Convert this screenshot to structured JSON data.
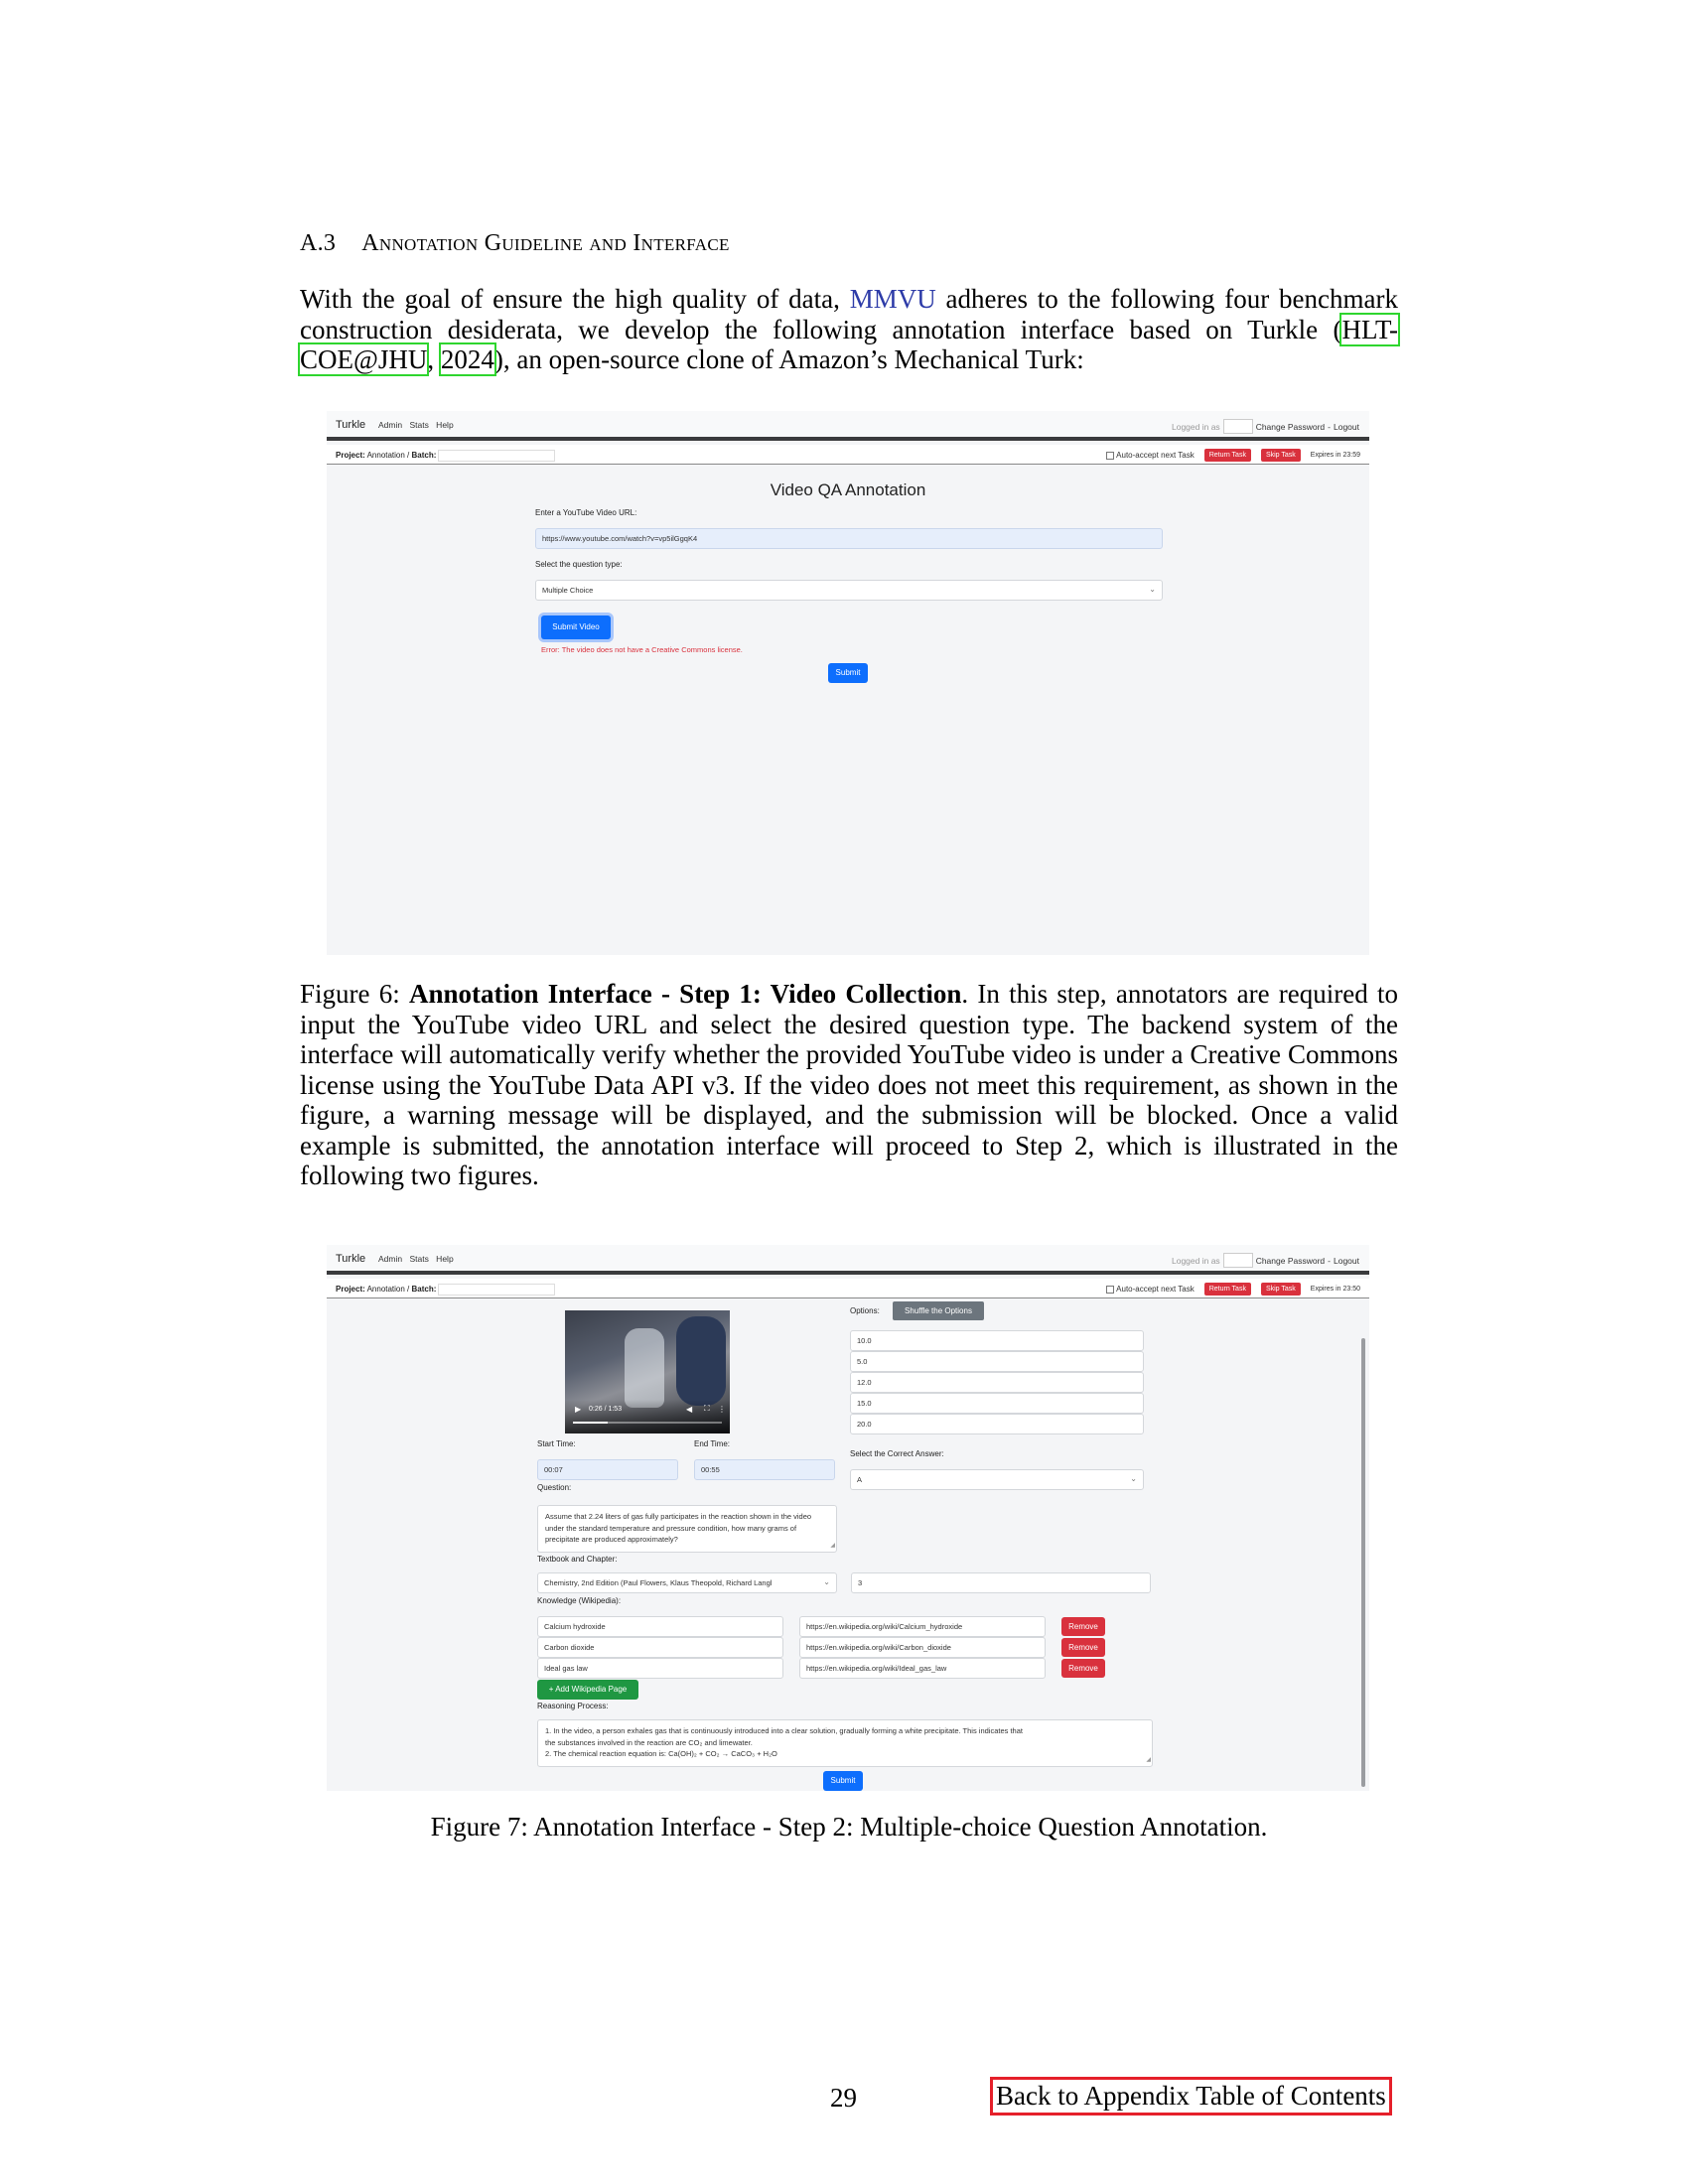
{
  "section": {
    "number": "A.3",
    "title": "Annotation Guideline and Interface"
  },
  "intro": {
    "text_before": "With the goal of ensure the high quality of data, ",
    "mmvu": "MMVU",
    "text_middle": " adheres to the following four benchmark construction desiderata, we develop the following annotation interface based on Turkle (",
    "cite_author": "HLT-COE@JHU",
    "cite_sep": ", ",
    "cite_year": "2024",
    "text_after": "), an open-source clone of Amazon’s Mechanical Turk:"
  },
  "nav": {
    "brand": "Turkle",
    "links": "Admin Stats Help",
    "logged_in": "Logged in as",
    "change_password": "Change Password",
    "separator": "-",
    "logout": "Logout"
  },
  "project_bar": {
    "project_label": "Project:",
    "project_value": "Annotation /",
    "batch_label": "Batch:",
    "auto_accept": "Auto-accept next Task",
    "return_task": "Return Task",
    "skip_task": "Skip Task"
  },
  "figure6": {
    "expires": "Expires in 23:59",
    "heading": "Video QA Annotation",
    "url_label": "Enter a YouTube Video URL:",
    "url_value": "https://www.youtube.com/watch?v=vp5ilGgqK4",
    "qtype_label": "Select the question type:",
    "qtype_value": "Multiple Choice",
    "submit_video": "Submit Video",
    "error": "Error: The video does not have a Creative Commons license.",
    "submit": "Submit",
    "caption_label": "Figure 6: ",
    "caption_bold": "Annotation Interface - Step 1: Video Collection",
    "caption_text": ". In this step, annotators are required to input the YouTube video URL and select the desired question type. The backend system of the interface will automatically verify whether the provided YouTube video is under a Creative Commons license using the YouTube Data API v3. If the video does not meet this requirement, as shown in the figure, a warning message will be displayed, and the submission will be blocked. Once a valid example is submitted, the annotation interface will proceed to Step 2, which is illustrated in the following two figures."
  },
  "figure7": {
    "expires": "Expires in 23:50",
    "video_time": "0:26 / 1:53",
    "start_label": "Start Time:",
    "start_value": "00:07",
    "end_label": "End Time:",
    "end_value": "00:55",
    "question_label": "Question:",
    "question_value": "Assume that 2.24 liters of gas fully participates in the reaction shown in the video under the standard temperature and pressure condition, how many grams of precipitate are produced approximately?",
    "textbook_label": "Textbook and Chapter:",
    "textbook_value": "Chemistry, 2nd Edition (Paul Flowers, Klaus Theopold, Richard Langl",
    "chapter_value": "3",
    "knowledge_label": "Knowledge (Wikipedia):",
    "knowledge": [
      {
        "term": "Calcium hydroxide",
        "url": "https://en.wikipedia.org/wiki/Calcium_hydroxide",
        "remove": "Remove"
      },
      {
        "term": "Carbon dioxide",
        "url": "https://en.wikipedia.org/wiki/Carbon_dioxide",
        "remove": "Remove"
      },
      {
        "term": "Ideal gas law",
        "url": "https://en.wikipedia.org/wiki/Ideal_gas_law",
        "remove": "Remove"
      }
    ],
    "add_wiki": "+ Add Wikipedia Page",
    "reasoning_label": "Reasoning Process:",
    "reasoning_line1": "1. In the video, a person exhales gas that is continuously introduced into a clear solution, gradually forming a white precipitate. This indicates that",
    "reasoning_line2": "the substances involved in the reaction are CO₂ and limewater.",
    "reasoning_line3": "2. The chemical reaction equation is: Ca(OH)₂ + CO₂ → CaCO₃ + H₂O",
    "options_label": "Options:",
    "shuffle": "Shuffle the Options",
    "options": [
      "10.0",
      "5.0",
      "12.0",
      "15.0",
      "20.0"
    ],
    "correct_label": "Select the Correct Answer:",
    "correct_value": "A",
    "submit": "Submit",
    "caption": "Figure 7: Annotation Interface - Step 2: Multiple-choice Question Annotation."
  },
  "footer": {
    "page_number": "29",
    "back_link": "Back to Appendix Table of Contents"
  }
}
